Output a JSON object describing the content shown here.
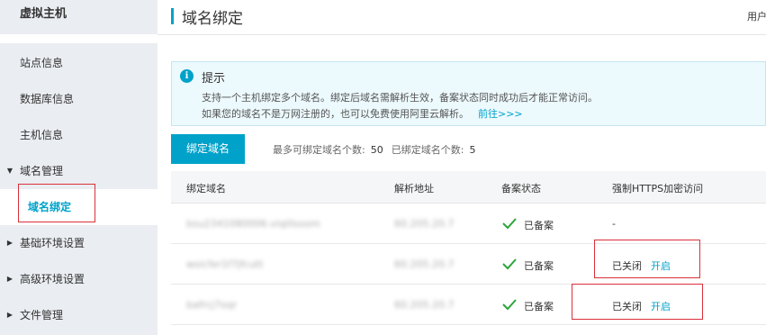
{
  "sidebar": {
    "title": "虚拟主机",
    "items": [
      {
        "label": "站点信息"
      },
      {
        "label": "数据库信息"
      },
      {
        "label": "主机信息"
      },
      {
        "label": "域名管理"
      },
      {
        "label": "域名绑定"
      },
      {
        "label": "基础环境设置"
      },
      {
        "label": "高级环境设置"
      },
      {
        "label": "文件管理"
      }
    ]
  },
  "header": {
    "title": "域名绑定",
    "user_link": "用户"
  },
  "tip": {
    "title": "提示",
    "line1": "支持一个主机绑定多个域名。绑定后域名需解析生效，备案状态同时成功后才能正常访问。",
    "line2": "如果您的域名不是万网注册的，也可以免费使用阿里云解析。",
    "link": "前往>>>"
  },
  "toolbar": {
    "bind_button": "绑定域名",
    "max_label": "最多可绑定域名个数:",
    "max_value": "50",
    "bound_label": "已绑定域名个数:",
    "bound_value": "5"
  },
  "table": {
    "columns": [
      "绑定域名",
      "解析地址",
      "备案状态",
      "强制HTTPS加密访问"
    ],
    "rows": [
      {
        "domain": "bsu2341080006.viqillsoom",
        "address": "60.205.20.7",
        "status": "已备案",
        "https": "-",
        "https_state": "",
        "https_action": ""
      },
      {
        "domain": "wsicfer1f7jfcutt",
        "address": "60.205.20.7",
        "status": "已备案",
        "https": "",
        "https_state": "已关闭",
        "https_action": "开启"
      },
      {
        "domain": "bafrcj7oqr",
        "address": "60.205.20.7",
        "status": "已备案",
        "https": "",
        "https_state": "已关闭",
        "https_action": "开启"
      }
    ]
  },
  "colors": {
    "accent": "#00a2ca",
    "highlight_box": "#d9303a",
    "check": "#2ca53a"
  }
}
